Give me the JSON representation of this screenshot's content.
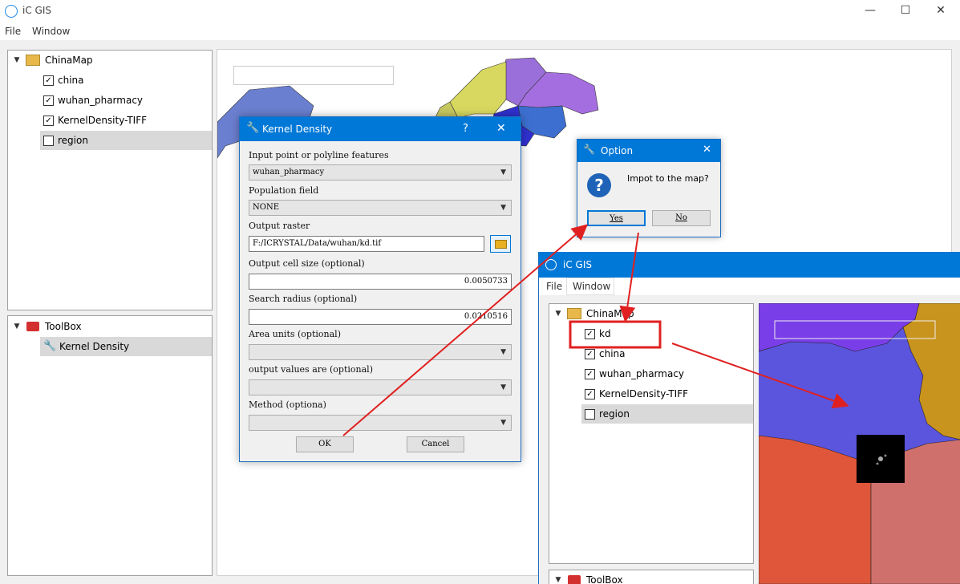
{
  "window": {
    "title": "iC GIS",
    "minimize": "—",
    "maximize": "☐",
    "close": "✕"
  },
  "menu": {
    "file": "File",
    "window": "Window"
  },
  "layers_panel": {
    "group": "ChinaMap",
    "items": [
      {
        "label": "china",
        "checked": "✓"
      },
      {
        "label": "wuhan_pharmacy",
        "checked": "✓"
      },
      {
        "label": "KernelDensity-TIFF",
        "checked": "✓"
      },
      {
        "label": "region",
        "checked": ""
      }
    ]
  },
  "toolbox_panel": {
    "group": "ToolBox",
    "tool": "Kernel Density"
  },
  "kernel_density": {
    "title": "Kernel Density",
    "help": "?",
    "close": "✕",
    "input_label": "Input point or polyline features",
    "input_value": "wuhan_pharmacy",
    "population_label": "Population field",
    "population_value": "NONE",
    "output_label": "Output raster",
    "output_value": "F:/ICRYSTAL/Data/wuhan/kd.tif",
    "cell_label": "Output cell size (optional)",
    "cell_value": "0.0050733",
    "radius_label": "Search radius (optional)",
    "radius_value": "0.0210516",
    "area_label": "Area units (optional)",
    "output_values_label": "output values are (optional)",
    "method_label": "Method (optiona)",
    "ok": "OK",
    "cancel": "Cancel"
  },
  "option_dialog": {
    "title": "Option",
    "close": "✕",
    "message": "Impot to the map?",
    "yes": "Yes",
    "no": "No"
  },
  "second_window": {
    "title": "iC GIS",
    "menu": {
      "file": "File",
      "window": "Window"
    },
    "group": "ChinaMap",
    "items": [
      {
        "label": "kd",
        "checked": "✓"
      },
      {
        "label": "china",
        "checked": "✓"
      },
      {
        "label": "wuhan_pharmacy",
        "checked": "✓"
      },
      {
        "label": "KernelDensity-TIFF",
        "checked": "✓"
      },
      {
        "label": "region",
        "checked": ""
      }
    ],
    "toolbox": "ToolBox"
  },
  "colors": {
    "accent": "#0078d7",
    "annotation": "#e02020"
  }
}
